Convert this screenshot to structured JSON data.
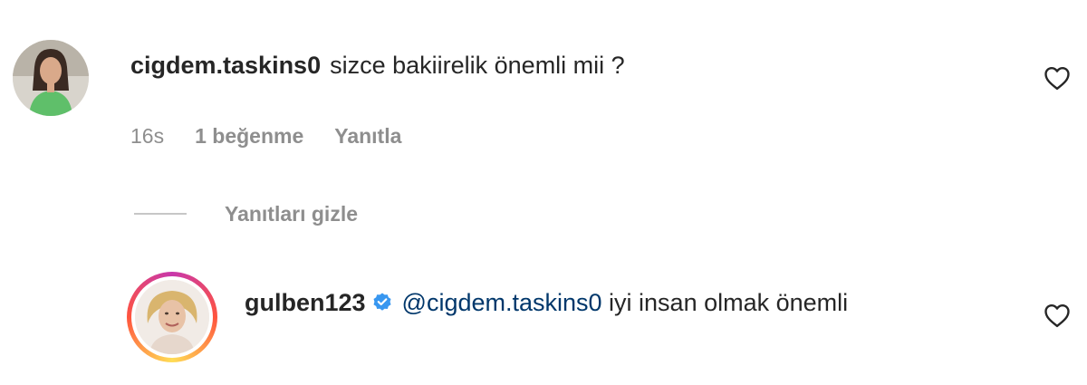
{
  "comments": [
    {
      "username": "cigdem.taskins0",
      "text": "sizce bakiirelik önemli mii ?",
      "time": "16s",
      "likes": "1 beğenme",
      "reply_label": "Yanıtla",
      "heart_icon": "heart-outline-icon"
    }
  ],
  "replies_toggle": {
    "label": "Yanıtları gizle"
  },
  "reply": {
    "username": "gulben123",
    "verified": true,
    "mention": "@cigdem.taskins0",
    "text": " iyi insan olmak önemli",
    "heart_icon": "heart-outline-icon"
  },
  "colors": {
    "text": "#262626",
    "secondary": "#8e8e8e",
    "mention": "#00376b",
    "verified_badge": "#3897f0",
    "story_ring": [
      "#c837ab",
      "#ff543e",
      "#ffdd55"
    ]
  }
}
